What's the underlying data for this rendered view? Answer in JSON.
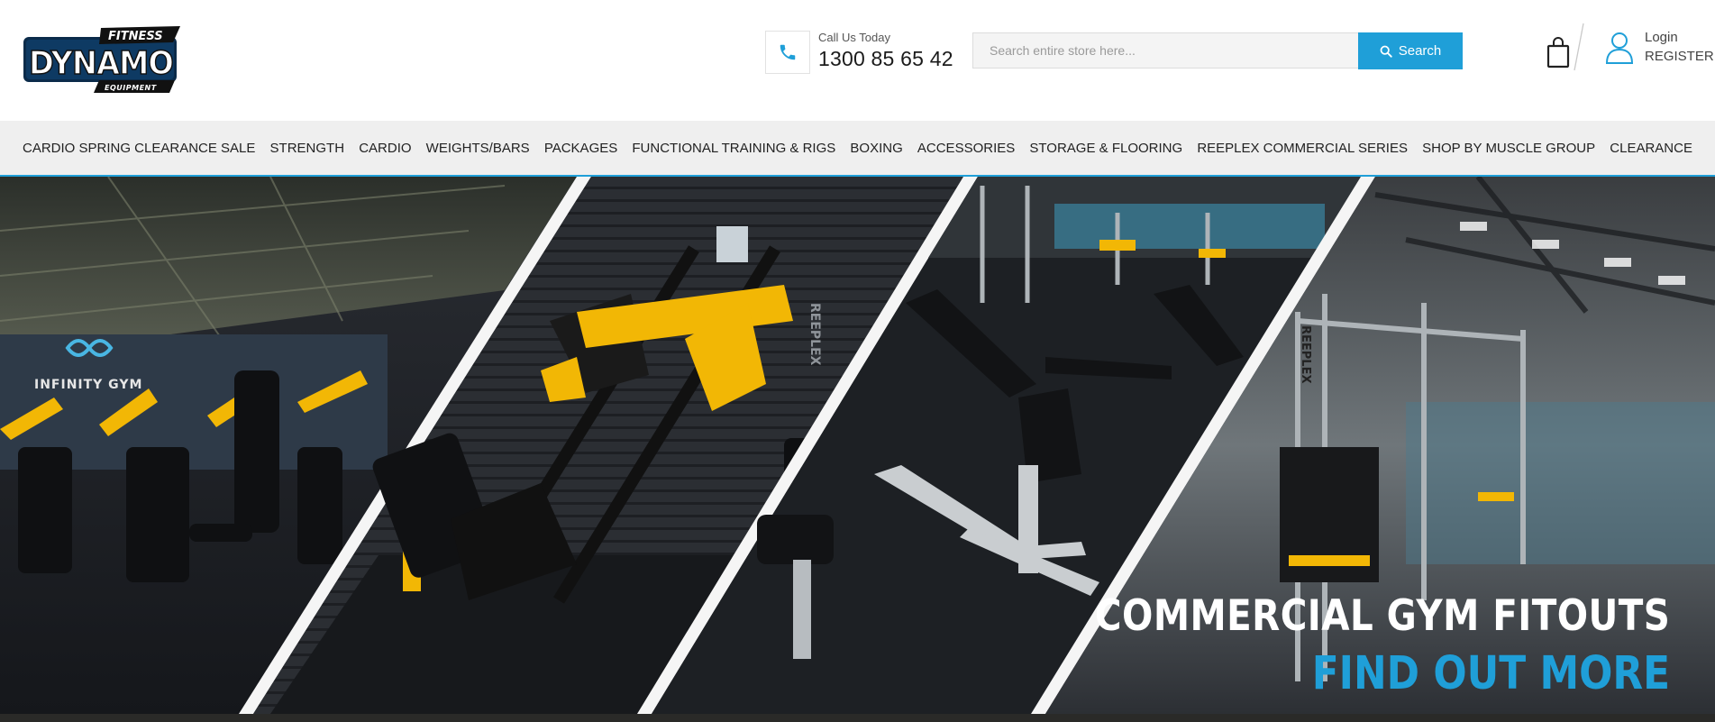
{
  "header": {
    "logo": {
      "word": "DYNAMO",
      "tag_top": "FITNESS",
      "tag_bottom": "EQUIPMENT"
    },
    "call_label": "Call Us Today",
    "call_number": "1300 85 65 42",
    "search": {
      "placeholder": "Search entire store here...",
      "button_label": "Search"
    },
    "account": {
      "login": "Login",
      "register": "REGISTER"
    }
  },
  "nav": {
    "items": [
      "CARDIO SPRING CLEARANCE SALE",
      "STRENGTH",
      "CARDIO",
      "WEIGHTS/BARS",
      "PACKAGES",
      "FUNCTIONAL TRAINING & RIGS",
      "BOXING",
      "ACCESSORIES",
      "STORAGE & FLOORING",
      "REEPLEX COMMERCIAL SERIES",
      "SHOP BY MUSCLE GROUP",
      "CLEARANCE"
    ]
  },
  "hero": {
    "title": "COMMERCIAL GYM FITOUTS",
    "cta": "FIND OUT MORE",
    "panel1_sign": "INFINITY GYM",
    "panel2_brand": "REEPLEX",
    "panel4_brand": "REEPLEX"
  },
  "colors": {
    "accent": "#1f9fd8",
    "equipment_yellow": "#f2b705",
    "dark": "#1b1b1b"
  }
}
